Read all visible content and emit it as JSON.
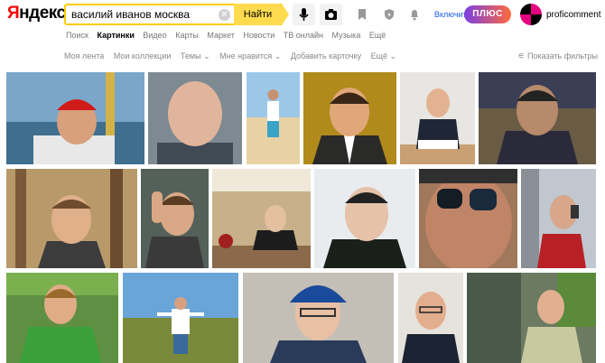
{
  "header": {
    "logo_first": "Я",
    "logo_rest": "ндекс",
    "search_query": "василий иванов москва",
    "find_label": "Найти",
    "plus_link": "Включить",
    "plus_badge": "ПЛЮС",
    "user_name": "proficomment"
  },
  "services": [
    {
      "label": "Поиск",
      "active": false
    },
    {
      "label": "Картинки",
      "active": true
    },
    {
      "label": "Видео",
      "active": false
    },
    {
      "label": "Карты",
      "active": false
    },
    {
      "label": "Маркет",
      "active": false
    },
    {
      "label": "Новости",
      "active": false
    },
    {
      "label": "ТВ онлайн",
      "active": false
    },
    {
      "label": "Музыка",
      "active": false
    },
    {
      "label": "Ещё",
      "active": false
    }
  ],
  "subnav": {
    "my_feed": "Моя лента",
    "my_collections": "Мои коллекции",
    "themes": "Темы ⌄",
    "likes": "Мне нравится ⌄",
    "add_card": "Добавить карточку",
    "more": "Ещё ⌄",
    "show_filters": "Показать фильтры"
  },
  "colors": {
    "search_border": "#ffcc00",
    "find_button": "#ffdb4d",
    "link_blue": "#1a5ee0"
  },
  "images": [
    {
      "name": "image-result-1",
      "scene": "man-red-cap-lake"
    },
    {
      "name": "image-result-2",
      "scene": "bald-man-closeup"
    },
    {
      "name": "image-result-3",
      "scene": "man-on-beach"
    },
    {
      "name": "image-result-4",
      "scene": "man-suit-yellow"
    },
    {
      "name": "image-result-5",
      "scene": "man-suit-desk"
    },
    {
      "name": "image-result-6",
      "scene": "man-on-couch"
    },
    {
      "name": "image-result-7",
      "scene": "man-in-forest"
    },
    {
      "name": "image-result-8",
      "scene": "man-hand-on-head"
    },
    {
      "name": "image-result-9",
      "scene": "man-in-cafe"
    },
    {
      "name": "image-result-10",
      "scene": "man-selfie-dark"
    },
    {
      "name": "image-result-11",
      "scene": "man-sunglasses"
    },
    {
      "name": "image-result-12",
      "scene": "man-phone-red-shirt"
    },
    {
      "name": "image-result-13",
      "scene": "man-green-shirt-field"
    },
    {
      "name": "image-result-14",
      "scene": "man-arms-out-field"
    },
    {
      "name": "image-result-15",
      "scene": "man-blue-cap"
    },
    {
      "name": "image-result-16",
      "scene": "man-suit-glasses"
    },
    {
      "name": "image-result-17",
      "scene": "man-in-room"
    }
  ]
}
